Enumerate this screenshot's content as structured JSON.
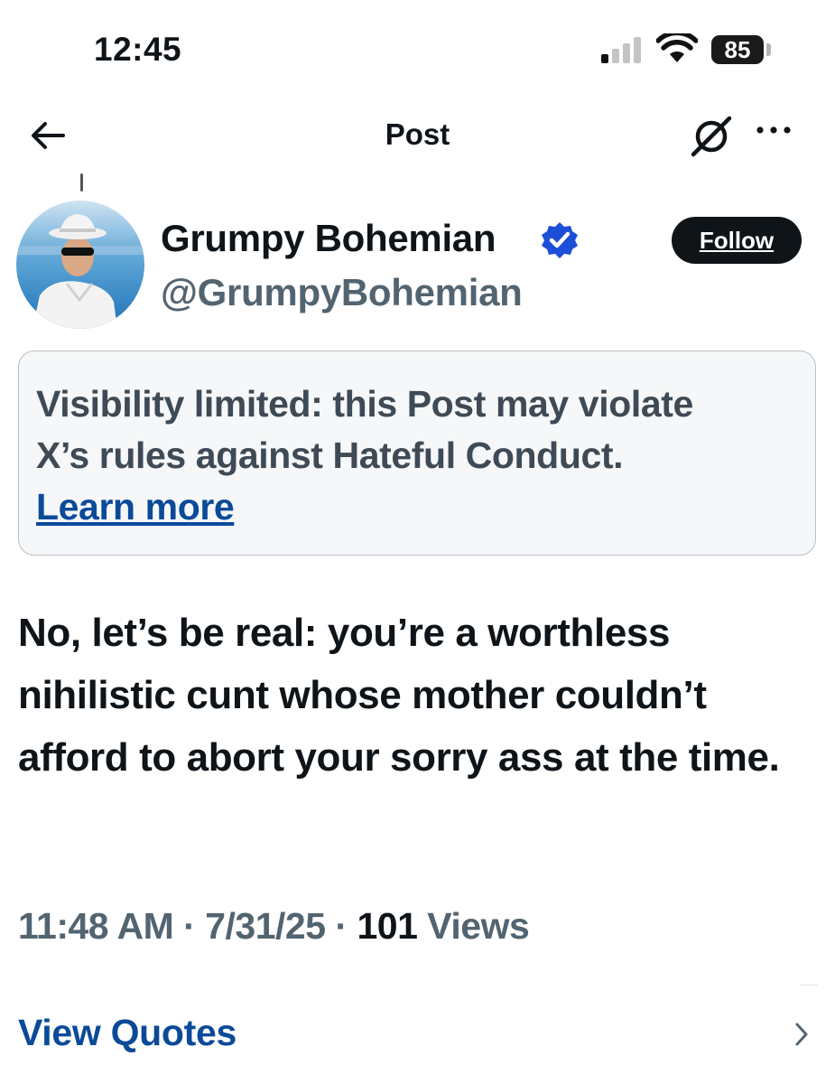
{
  "status_bar": {
    "time": "12:45",
    "battery": "85",
    "icons": [
      "cellular-signal-icon",
      "wifi-icon",
      "battery-icon"
    ]
  },
  "header": {
    "title": "Post",
    "icons": [
      "back-arrow-icon",
      "grok-icon",
      "more-options-icon"
    ]
  },
  "author": {
    "name": "Grumpy Bohemian",
    "handle": "@GrumpyBohemian",
    "verified": true,
    "verified_color": "#1d9bf0",
    "follow_label": "Follow"
  },
  "notice": {
    "line1": "Visibility limited: this Post may violate",
    "line2": "X’s rules against Hateful Conduct.",
    "link": "Learn more"
  },
  "post": {
    "text": "No, let’s be real: you’re a worthless nihilistic cunt whose mother couldn’t afford to abort your sorry ass at the time.",
    "time": "11:48 AM",
    "separator": "·",
    "date": "7/31/25",
    "views_count": "101",
    "views_label": "Views"
  },
  "actions": {
    "view_quotes": "View Quotes"
  },
  "colors": {
    "text": "#0f1419",
    "secondary": "#536471",
    "link": "#0b4a99",
    "notice_bg": "#f5f7f8"
  }
}
